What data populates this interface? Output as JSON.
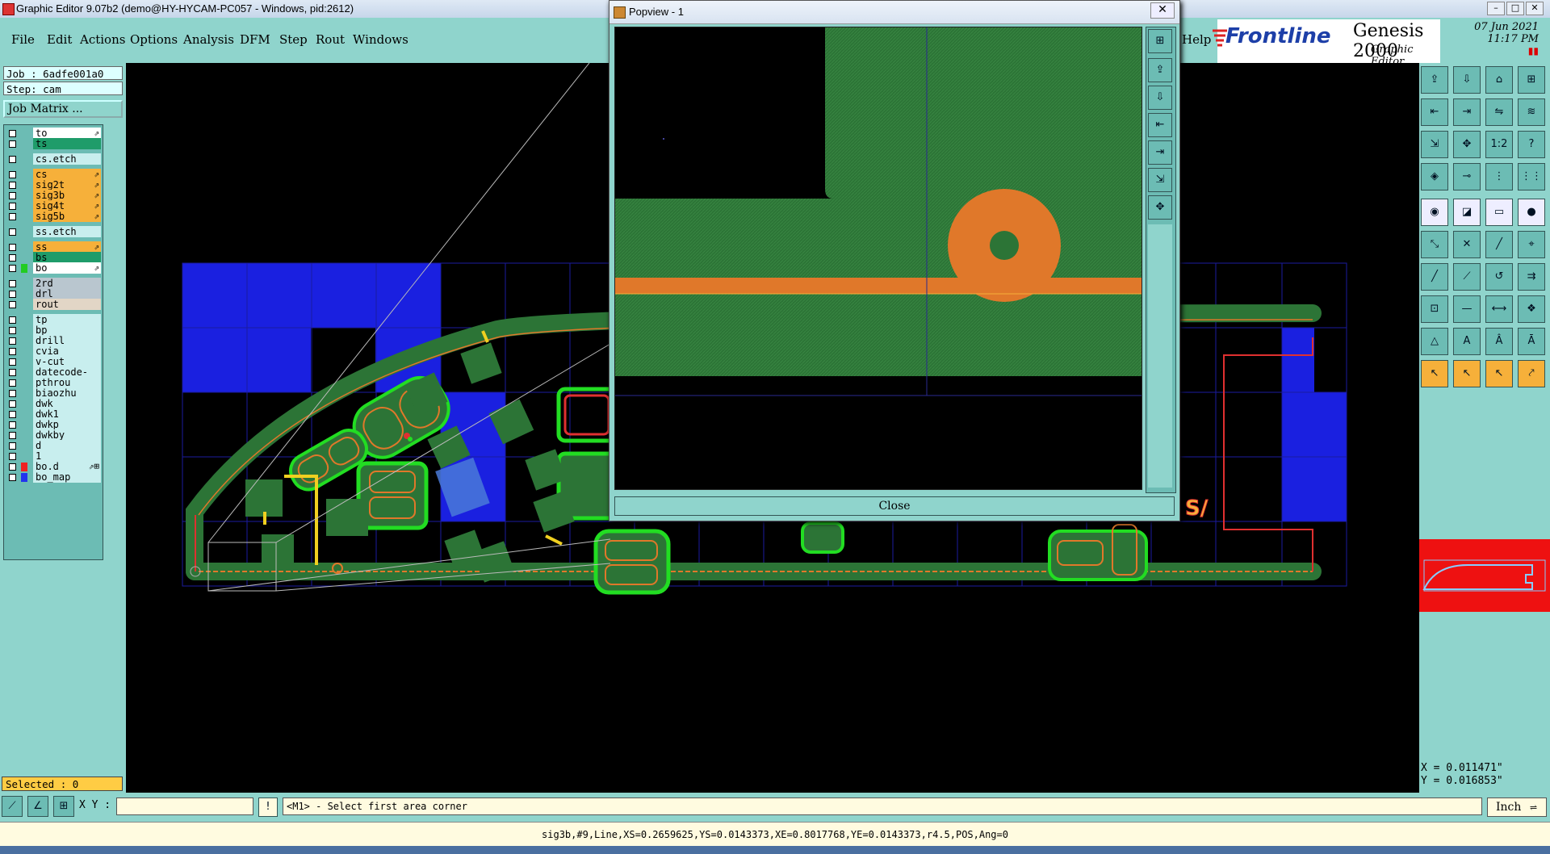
{
  "window": {
    "title": "Graphic Editor 9.07b2 (demo@HY-HYCAM-PC057 - Windows, pid:2612)",
    "controls": [
      "–",
      "□",
      "✕"
    ]
  },
  "menu": {
    "items": [
      "File",
      "Edit",
      "Actions",
      "Options",
      "Analysis",
      "DFM",
      "Step",
      "Rout",
      "Windows"
    ],
    "help": "Help"
  },
  "brand": {
    "logo": "Frontline",
    "product": "Genesis 2000",
    "subtitle": "Graphic Editor",
    "date": "07 Jun 2021",
    "time": "11:17 PM"
  },
  "job": {
    "job_label": "Job : 6adfe001a0",
    "step_label": "Step: cam",
    "job_matrix_button": "Job Matrix ..."
  },
  "layers": [
    {
      "name": "to",
      "bg": "#ffffff",
      "sw": "",
      "edit": "⇗",
      "gap": false
    },
    {
      "name": "ts",
      "bg": "#1f9c6a",
      "sw": "",
      "edit": "",
      "gap": false
    },
    {
      "name": "cs.etch",
      "bg": "#c8eeee",
      "sw": "",
      "edit": "",
      "gap": true
    },
    {
      "name": "cs",
      "bg": "#f6b03a",
      "sw": "",
      "edit": "⇗",
      "gap": true
    },
    {
      "name": "sig2t",
      "bg": "#f6b03a",
      "sw": "",
      "edit": "⇗",
      "gap": false
    },
    {
      "name": "sig3b",
      "bg": "#f6b03a",
      "sw": "",
      "edit": "⇗",
      "gap": false
    },
    {
      "name": "sig4t",
      "bg": "#f6b03a",
      "sw": "",
      "edit": "⇗",
      "gap": false
    },
    {
      "name": "sig5b",
      "bg": "#f6b03a",
      "sw": "",
      "edit": "⇗",
      "gap": false
    },
    {
      "name": "ss.etch",
      "bg": "#c8eeee",
      "sw": "",
      "edit": "",
      "gap": true
    },
    {
      "name": "ss",
      "bg": "#f6b03a",
      "sw": "",
      "edit": "⇗",
      "gap": true
    },
    {
      "name": "bs",
      "bg": "#1f9c6a",
      "sw": "",
      "edit": "",
      "gap": false
    },
    {
      "name": "bo",
      "bg": "#ffffff",
      "sw": "#22cc22",
      "edit": "⇗",
      "gap": false
    },
    {
      "name": "2rd",
      "bg": "#b9c6cf",
      "sw": "",
      "edit": "",
      "gap": true
    },
    {
      "name": "drl",
      "bg": "#b9c6cf",
      "sw": "",
      "edit": "",
      "gap": false
    },
    {
      "name": "rout",
      "bg": "#e2d6c6",
      "sw": "",
      "edit": "",
      "gap": false
    },
    {
      "name": "tp",
      "bg": "#c8eeee",
      "sw": "",
      "edit": "",
      "gap": true
    },
    {
      "name": "bp",
      "bg": "#c8eeee",
      "sw": "",
      "edit": "",
      "gap": false
    },
    {
      "name": "drill",
      "bg": "#c8eeee",
      "sw": "",
      "edit": "",
      "gap": false
    },
    {
      "name": "cvia",
      "bg": "#c8eeee",
      "sw": "",
      "edit": "",
      "gap": false
    },
    {
      "name": "v-cut",
      "bg": "#c8eeee",
      "sw": "",
      "edit": "",
      "gap": false
    },
    {
      "name": "datecode-pth",
      "bg": "#c8eeee",
      "sw": "",
      "edit": "",
      "gap": false
    },
    {
      "name": "pthrou",
      "bg": "#c8eeee",
      "sw": "",
      "edit": "",
      "gap": false
    },
    {
      "name": "biaozhu",
      "bg": "#c8eeee",
      "sw": "",
      "edit": "",
      "gap": false
    },
    {
      "name": "dwk",
      "bg": "#c8eeee",
      "sw": "",
      "edit": "",
      "gap": false
    },
    {
      "name": "dwk1",
      "bg": "#c8eeee",
      "sw": "",
      "edit": "",
      "gap": false
    },
    {
      "name": "dwkp",
      "bg": "#c8eeee",
      "sw": "",
      "edit": "",
      "gap": false
    },
    {
      "name": "dwkby",
      "bg": "#c8eeee",
      "sw": "",
      "edit": "",
      "gap": false
    },
    {
      "name": "d",
      "bg": "#c8eeee",
      "sw": "",
      "edit": "",
      "gap": false
    },
    {
      "name": "1",
      "bg": "#c8eeee",
      "sw": "",
      "edit": "",
      "gap": false
    },
    {
      "name": "bo.d",
      "bg": "#c8eeee",
      "sw": "#ee2222",
      "edit": "⇗⊞",
      "gap": false
    },
    {
      "name": "bo_map",
      "bg": "#c8eeee",
      "sw": "#2233ee",
      "edit": "",
      "gap": false
    }
  ],
  "selected": "Selected : 0",
  "coords": {
    "x": "X = 0.011471\"",
    "y": "Y = 0.016853\""
  },
  "bottom": {
    "xy_label": "X Y :",
    "xy_value": "",
    "info_icon": "!",
    "prompt": "<M1> - Select first area corner",
    "units": "Inch"
  },
  "status_line": "sig3b,#9,Line,XS=0.2659625,YS=0.0143373,XE=0.8017768,YE=0.0143373,r4.5,POS,Ang=0",
  "popview": {
    "title": "Popview - 1",
    "close_x": "✕",
    "close_button": "Close"
  },
  "canvas_text": {
    "marker": "S/"
  },
  "toolbar": [
    {
      "name": "open-step-icon",
      "glyph": "⇪",
      "cls": ""
    },
    {
      "name": "save-icon",
      "glyph": "⇩",
      "cls": ""
    },
    {
      "name": "home-icon",
      "glyph": "⌂",
      "cls": ""
    },
    {
      "name": "panel-icon",
      "glyph": "⊞",
      "cls": ""
    },
    {
      "name": "left-snap-icon",
      "glyph": "⇤",
      "cls": ""
    },
    {
      "name": "right-snap-icon",
      "glyph": "⇥",
      "cls": ""
    },
    {
      "name": "switch-icon",
      "glyph": "⇋",
      "cls": ""
    },
    {
      "name": "wave-icon",
      "glyph": "≋",
      "cls": ""
    },
    {
      "name": "zoom-fit-icon",
      "glyph": "⇲",
      "cls": ""
    },
    {
      "name": "zoom-in-icon",
      "glyph": "✥",
      "cls": ""
    },
    {
      "name": "scale-icon",
      "glyph": "1:2",
      "cls": ""
    },
    {
      "name": "help-icon",
      "glyph": "?",
      "cls": ""
    },
    {
      "name": "layer-icon",
      "glyph": "◈",
      "cls": ""
    },
    {
      "name": "probe-icon",
      "glyph": "⊸",
      "cls": ""
    },
    {
      "name": "net-icon",
      "glyph": "⋮",
      "cls": ""
    },
    {
      "name": "net2-icon",
      "glyph": "⋮⋮",
      "cls": ""
    },
    {
      "name": "pad-icon",
      "glyph": "◉",
      "cls": "white"
    },
    {
      "name": "shape-icon",
      "glyph": "◪",
      "cls": "white"
    },
    {
      "name": "ruler-icon",
      "glyph": "▭",
      "cls": "white"
    },
    {
      "name": "dot-icon",
      "glyph": "●",
      "cls": "white"
    },
    {
      "name": "connect-icon",
      "glyph": "⤡",
      "cls": ""
    },
    {
      "name": "cross-icon",
      "glyph": "✕",
      "cls": ""
    },
    {
      "name": "line-icon",
      "glyph": "╱",
      "cls": ""
    },
    {
      "name": "pin-icon",
      "glyph": "⌖",
      "cls": ""
    },
    {
      "name": "draw-line-icon",
      "glyph": "╱",
      "cls": ""
    },
    {
      "name": "diag-icon",
      "glyph": "⟋",
      "cls": ""
    },
    {
      "name": "arc-icon",
      "glyph": "↺",
      "cls": ""
    },
    {
      "name": "align-icon",
      "glyph": "⇉",
      "cls": ""
    },
    {
      "name": "node-icon",
      "glyph": "⊡",
      "cls": ""
    },
    {
      "name": "minus-icon",
      "glyph": "—",
      "cls": ""
    },
    {
      "name": "measure-icon",
      "glyph": "⟷",
      "cls": ""
    },
    {
      "name": "group-icon",
      "glyph": "❖",
      "cls": ""
    },
    {
      "name": "triangle-icon",
      "glyph": "△",
      "cls": ""
    },
    {
      "name": "text-a-icon",
      "glyph": "A",
      "cls": ""
    },
    {
      "name": "text-a2-icon",
      "glyph": "Â",
      "cls": ""
    },
    {
      "name": "text-a3-icon",
      "glyph": "Ā",
      "cls": ""
    },
    {
      "name": "pointer-icon",
      "glyph": "↖",
      "cls": "orange"
    },
    {
      "name": "pointer-select-icon",
      "glyph": "↖",
      "cls": "orange"
    },
    {
      "name": "pointer-move-icon",
      "glyph": "↖",
      "cls": "orange"
    },
    {
      "name": "pointer-route-icon",
      "glyph": "⤤",
      "cls": "orange"
    }
  ],
  "theme": {
    "panel": "#8fd4cc",
    "board_green": "#2f7a3a",
    "copper_orange": "#e0782a",
    "outline_green": "#22dd22",
    "blue": "#1a20e0",
    "rout_red": "#e03030"
  }
}
